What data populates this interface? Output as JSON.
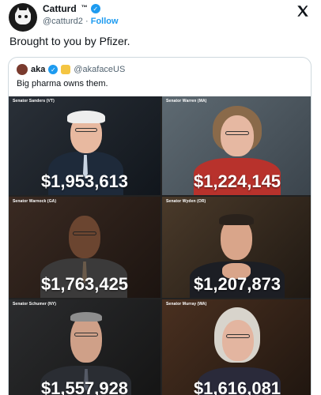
{
  "tweet": {
    "author_name": "Catturd",
    "tm": "™",
    "handle": "@catturd2",
    "separator": "·",
    "follow_label": "Follow",
    "x_logo": "𝕏",
    "text": "Brought to you by Pfizer."
  },
  "quote": {
    "author_name": "aka",
    "handle": "@akafaceUS",
    "text": "Big pharma owns them."
  },
  "senators": [
    {
      "label": "Senator Sanders (VT)",
      "amount": "$1,953,613"
    },
    {
      "label": "Senator Warren (MA)",
      "amount": "$1,224,145"
    },
    {
      "label": "Senator Warnock (GA)",
      "amount": "$1,763,425"
    },
    {
      "label": "Senator Wyden (OR)",
      "amount": "$1,207,873"
    },
    {
      "label": "Senator Schumer (NY)",
      "amount": "$1,557,928"
    },
    {
      "label": "Senator Murray (WA)",
      "amount": "$1,616,081"
    }
  ],
  "colors": {
    "verified": "#1d9bf0",
    "follow": "#1d9bf0",
    "text_primary": "#0f1419",
    "text_secondary": "#536471"
  }
}
